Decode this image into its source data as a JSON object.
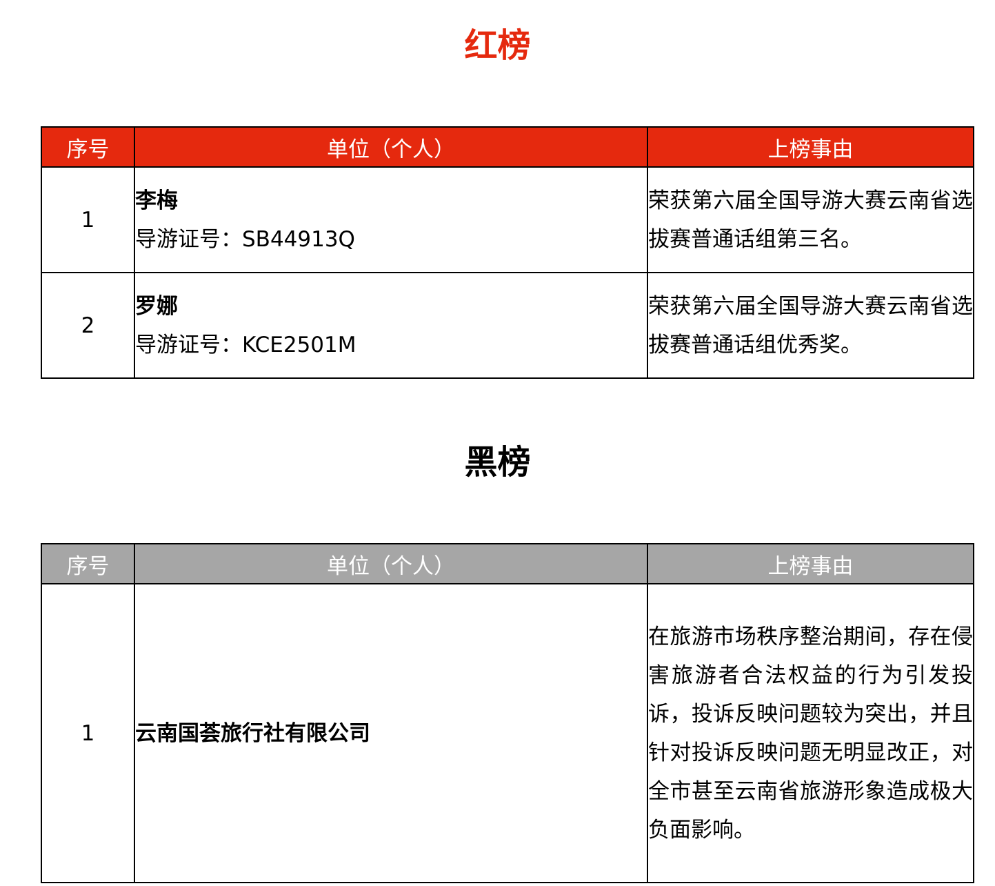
{
  "red": {
    "title": "红榜",
    "headers": {
      "idx": "序号",
      "unit": "单位（个人）",
      "reason": "上榜事由"
    },
    "rows": [
      {
        "idx": "1",
        "name": "李梅",
        "license": "导游证号：SB44913Q",
        "reason": "荣获第六届全国导游大赛云南省选拔赛普通话组第三名。"
      },
      {
        "idx": "2",
        "name": "罗娜",
        "license": "导游证号：KCE2501M",
        "reason": "荣获第六届全国导游大赛云南省选拔赛普通话组优秀奖。"
      }
    ]
  },
  "black": {
    "title": "黑榜",
    "headers": {
      "idx": "序号",
      "unit": "单位（个人）",
      "reason": "上榜事由"
    },
    "rows": [
      {
        "idx": "1",
        "name": "云南国荟旅行社有限公司",
        "reason": "在旅游市场秩序整治期间，存在侵害旅游者合法权益的行为引发投诉，投诉反映问题较为突出，并且针对投诉反映问题无明显改正，对全市甚至云南省旅游形象造成极大负面影响。"
      }
    ]
  }
}
